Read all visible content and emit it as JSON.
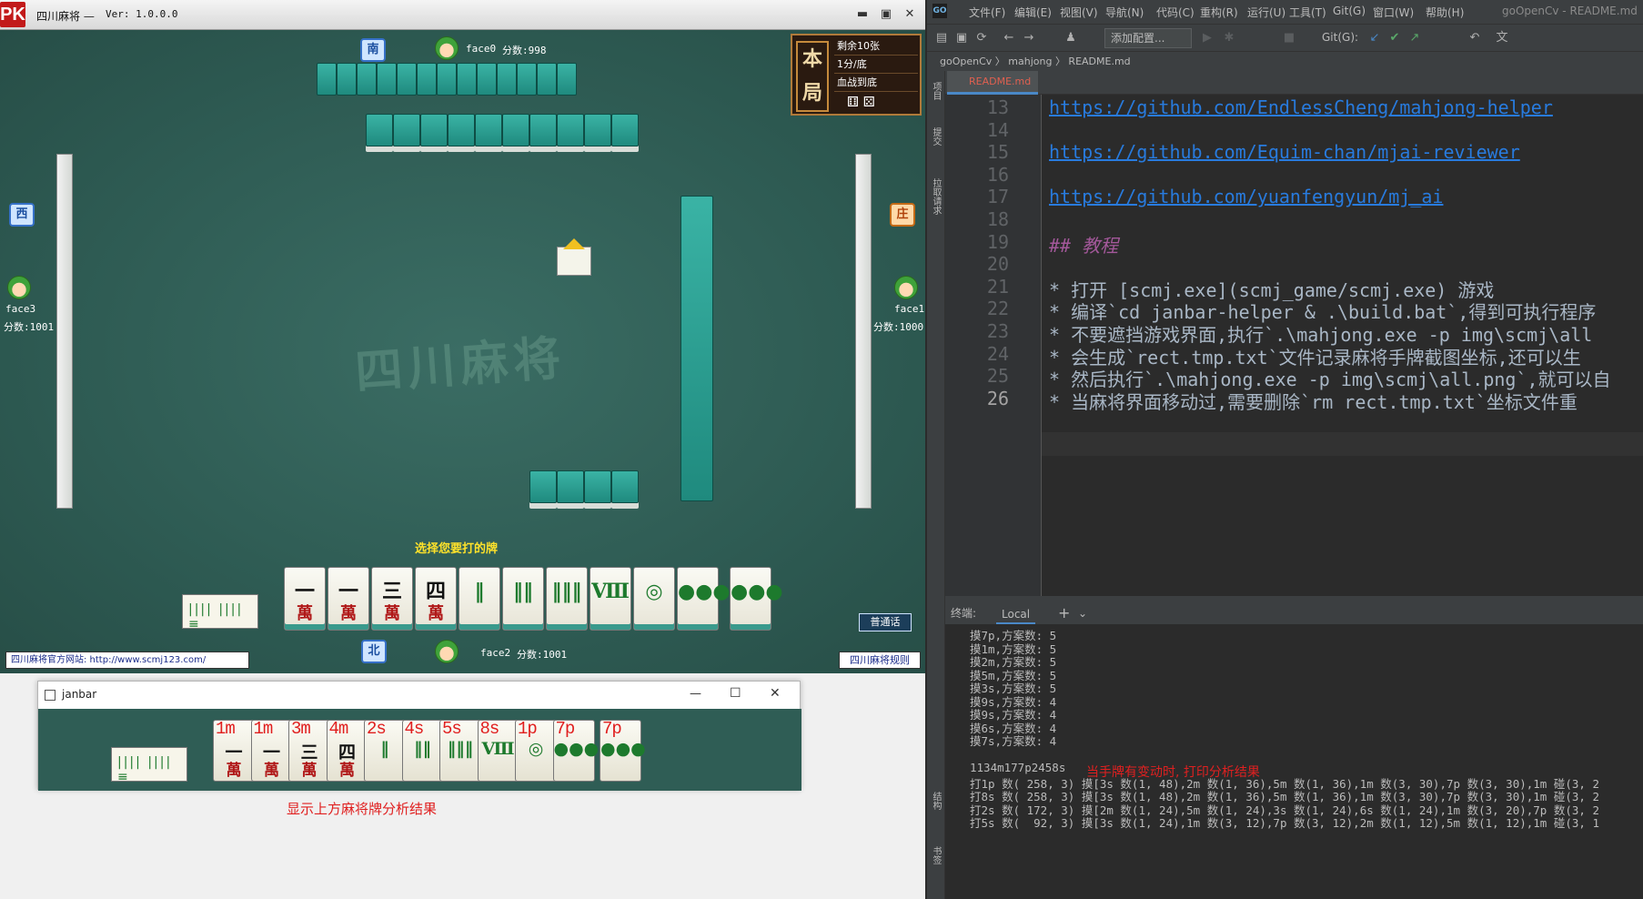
{
  "game": {
    "title": "四川麻将 —",
    "version": "Ver: 1.0.0.0",
    "window_buttons": [
      "▬",
      "▣",
      "✕"
    ],
    "logo": "PK",
    "info_panel": {
      "big": "本局",
      "rows": [
        "剩余10张",
        "1分/底",
        "血战到底"
      ]
    },
    "watermark": "四川麻将",
    "prompt": "选择您要打的牌",
    "talk_button": "普通话",
    "footer_left": "四川麻将官方网站: http://www.scmj123.com/",
    "footer_right": "四川麻将规则",
    "players": {
      "top": {
        "name": "face0",
        "score": "分数:998",
        "wind": "南"
      },
      "left": {
        "name": "face3",
        "score": "分数:1001",
        "wind": "西"
      },
      "right": {
        "name": "face1",
        "score": "分数:1000",
        "wind": "庄"
      },
      "bottom": {
        "name": "face2",
        "score": "分数:1001",
        "wind": "北"
      }
    },
    "hand_tiles": [
      {
        "g": "一",
        "w": "萬"
      },
      {
        "g": "一",
        "w": "萬"
      },
      {
        "g": "三",
        "w": "萬"
      },
      {
        "g": "四",
        "w": "萬"
      },
      {
        "g": "‖",
        "w": "",
        "s": true
      },
      {
        "g": "‖‖",
        "w": "",
        "s": true
      },
      {
        "g": "‖‖‖",
        "w": "",
        "s": true
      },
      {
        "g": "Ⅷ",
        "w": "",
        "s": true
      },
      {
        "g": "◎",
        "w": "",
        "s": true
      },
      {
        "g": "●●●",
        "w": "",
        "s": true
      },
      {
        "g": "●●●",
        "w": "",
        "s": true
      }
    ]
  },
  "janbar": {
    "title": "janbar",
    "window_buttons": [
      "—",
      "☐",
      "✕"
    ],
    "labels": [
      "1m",
      "1m",
      "3m",
      "4m",
      "2s",
      "4s",
      "5s",
      "8s",
      "1p",
      "7p",
      "7p"
    ],
    "tiles": [
      {
        "g": "一",
        "w": "萬"
      },
      {
        "g": "一",
        "w": "萬"
      },
      {
        "g": "三",
        "w": "萬"
      },
      {
        "g": "四",
        "w": "萬"
      },
      {
        "g": "‖",
        "w": "",
        "s": true
      },
      {
        "g": "‖‖",
        "w": "",
        "s": true
      },
      {
        "g": "‖‖‖",
        "w": "",
        "s": true
      },
      {
        "g": "Ⅷ",
        "w": "",
        "s": true
      },
      {
        "g": "◎",
        "w": "",
        "s": true
      },
      {
        "g": "●●●",
        "w": "",
        "s": true
      },
      {
        "g": "●●●",
        "w": "",
        "s": true
      }
    ],
    "caption": "显示上方麻将牌分析结果"
  },
  "ide": {
    "menu": [
      "文件(F)",
      "编辑(E)",
      "视图(V)",
      "导航(N)",
      "代码(C)",
      "重构(R)",
      "运行(U)",
      "工具(T)",
      "Git(G)",
      "窗口(W)",
      "帮助(H)",
      "goOpenCv - README.md"
    ],
    "add_config": "添加配置...",
    "git_label": "Git(G):",
    "breadcrumb": "goOpenCv 〉 mahjong 〉 README.md",
    "tab": "README.md",
    "side_labels": [
      "项目",
      "提交",
      "拉取请求"
    ],
    "bottom_side_labels": [
      "结构",
      "书签"
    ],
    "lines": [
      {
        "n": "13",
        "text": "https://github.com/EndlessCheng/mahjong-helper",
        "kind": "link"
      },
      {
        "n": "14",
        "text": "",
        "kind": "plain"
      },
      {
        "n": "15",
        "text": "https://github.com/Equim-chan/mjai-reviewer",
        "kind": "link"
      },
      {
        "n": "16",
        "text": "",
        "kind": "plain"
      },
      {
        "n": "17",
        "text": "https://github.com/yuanfengyun/mj_ai",
        "kind": "link"
      },
      {
        "n": "18",
        "text": "",
        "kind": "plain"
      },
      {
        "n": "19",
        "text": "## 教程",
        "kind": "hdr"
      },
      {
        "n": "20",
        "text": "",
        "kind": "plain"
      },
      {
        "n": "21",
        "text": "* 打开 [scmj.exe](scmj_game/scmj.exe) 游戏",
        "kind": "bullet"
      },
      {
        "n": "22",
        "text": "* 编译`cd janbar-helper & .\\build.bat`,得到可执行程序",
        "kind": "bullet"
      },
      {
        "n": "23",
        "text": "* 不要遮挡游戏界面,执行`.\\mahjong.exe -p img\\scmj\\all",
        "kind": "bullet"
      },
      {
        "n": "24",
        "text": "* 会生成`rect.tmp.txt`文件记录麻将手牌截图坐标,还可以生",
        "kind": "bullet"
      },
      {
        "n": "25",
        "text": "* 然后执行`.\\mahjong.exe -p img\\scmj\\all.png`,就可以自",
        "kind": "bullet"
      },
      {
        "n": "26",
        "text": "* 当麻将界面移动过,需要删除`rm rect.tmp.txt`坐标文件重",
        "kind": "bullet"
      }
    ],
    "terminal_label": "终端:",
    "terminal_tab": "Local",
    "terminal_lines": [
      "摸7p,方案数: 5",
      "摸1m,方案数: 5",
      "摸2m,方案数: 5",
      "摸5m,方案数: 5",
      "摸3s,方案数: 5",
      "摸9s,方案数: 4",
      "摸9s,方案数: 4",
      "摸6s,方案数: 4",
      "摸7s,方案数: 4",
      "",
      "1134m177p2458s",
      "打1p 数( 258, 3) 摸[3s 数(1, 48),2m 数(1, 36),5m 数(1, 36),1m 数(3, 30),7p 数(3, 30),1m 碰(3, 2",
      "打8s 数( 258, 3) 摸[3s 数(1, 48),2m 数(1, 36),5m 数(1, 36),1m 数(3, 30),7p 数(3, 30),1m 碰(3, 2",
      "打2s 数( 172, 3) 摸[2m 数(1, 24),5m 数(1, 24),3s 数(1, 24),6s 数(1, 24),1m 数(3, 20),7p 数(3, 2",
      "打5s 数(  92, 3) 摸[3s 数(1, 24),1m 数(3, 12),7p 数(3, 12),2m 数(1, 12),5m 数(1, 12),1m 碰(3, 1"
    ],
    "terminal_note": "当手牌有变动时, 打印分析结果"
  }
}
